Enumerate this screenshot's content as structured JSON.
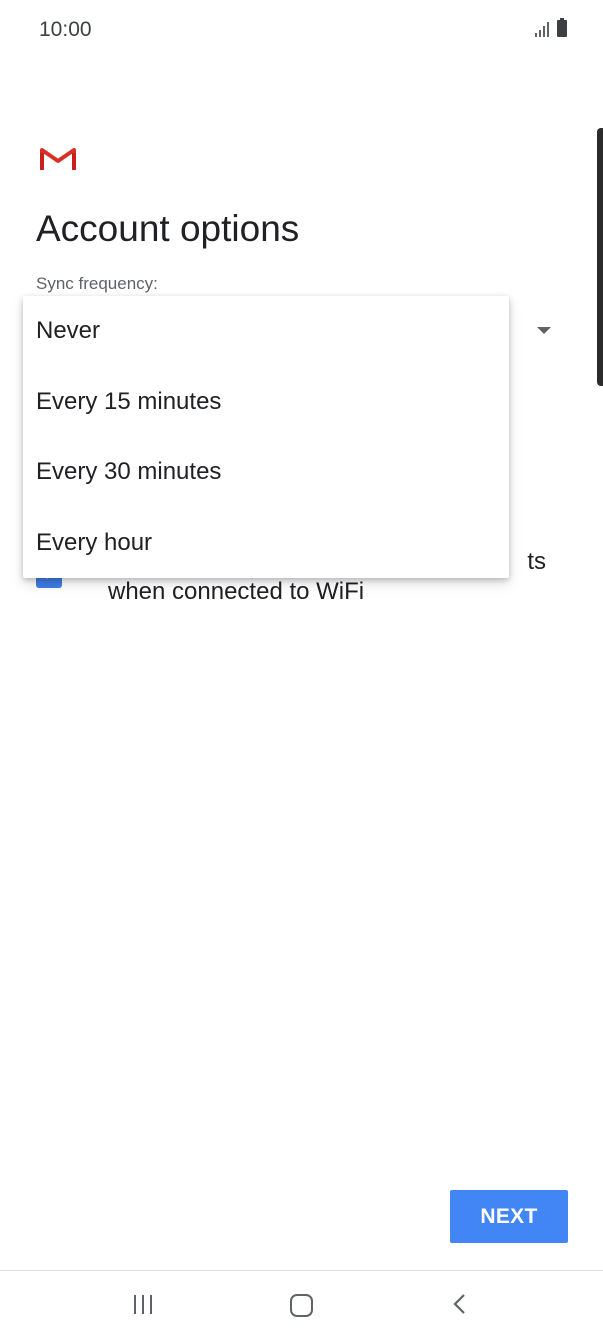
{
  "status_bar": {
    "time": "10:00",
    "icons": [
      "signal-icon",
      "battery-icon"
    ]
  },
  "header": {
    "logo": "gmail-logo-icon",
    "title": "Account options",
    "sync_label": "Sync frequency:"
  },
  "sync_menu": {
    "items": [
      {
        "label": "Never"
      },
      {
        "label": "Every 15 minutes"
      },
      {
        "label": "Every 30 minutes"
      },
      {
        "label": "Every hour"
      }
    ]
  },
  "attachments_option": {
    "checked": true,
    "label_visible_end": "ts",
    "label_line2": "when connected to WiFi"
  },
  "footer": {
    "next_label": "NEXT"
  },
  "nav_bar": {
    "icons": [
      "recent-apps-icon",
      "home-icon",
      "back-icon"
    ]
  },
  "colors": {
    "accent": "#4285f4",
    "checkbox": "#3f7de6",
    "gmail_red": "#d93025"
  }
}
